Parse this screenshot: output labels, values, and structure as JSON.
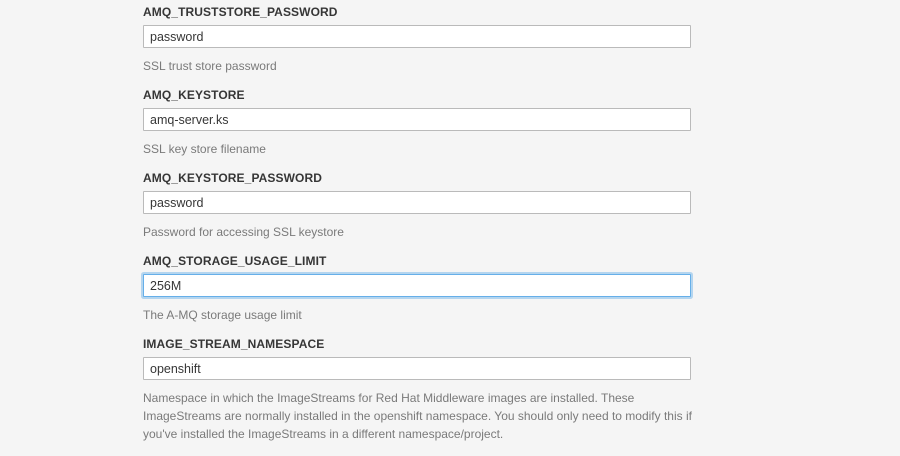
{
  "fields": [
    {
      "label": "AMQ_TRUSTSTORE_PASSWORD",
      "value": "password",
      "help": "SSL trust store password"
    },
    {
      "label": "AMQ_KEYSTORE",
      "value": "amq-server.ks",
      "help": "SSL key store filename"
    },
    {
      "label": "AMQ_KEYSTORE_PASSWORD",
      "value": "password",
      "help": "Password for accessing SSL keystore"
    },
    {
      "label": "AMQ_STORAGE_USAGE_LIMIT",
      "value": "256M",
      "help": "The A-MQ storage usage limit"
    },
    {
      "label": "IMAGE_STREAM_NAMESPACE",
      "value": "openshift",
      "help": "Namespace in which the ImageStreams for Red Hat Middleware images are installed. These ImageStreams are normally installed in the openshift namespace. You should only need to modify this if you've installed the ImageStreams in a different namespace/project."
    }
  ]
}
